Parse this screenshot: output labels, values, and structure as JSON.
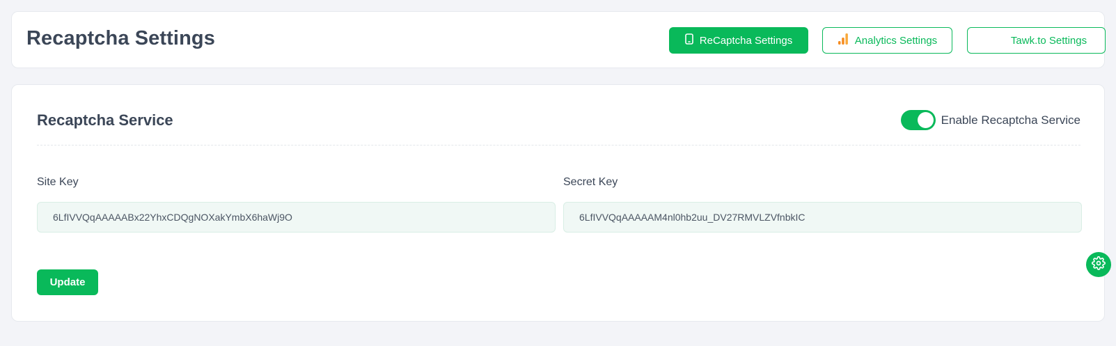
{
  "page": {
    "title": "Recaptcha Settings"
  },
  "header_buttons": {
    "recaptcha": {
      "label": "ReCaptcha Settings",
      "icon": "phone-icon"
    },
    "analytics": {
      "label": "Analytics Settings",
      "icon": "bar-chart-icon"
    },
    "tawk": {
      "label": "Tawk.to Settings"
    }
  },
  "service": {
    "title": "Recaptcha Service",
    "toggle_label": "Enable Recaptcha Service",
    "toggle_on": true
  },
  "fields": {
    "site_key": {
      "label": "Site Key",
      "value": "6LfIVVQqAAAAABx22YhxCDQgNOXakYmbX6haWj9O"
    },
    "secret_key": {
      "label": "Secret Key",
      "value": "6LfIVVQqAAAAAM4nl0hb2uu_DV27RMVLZVfnbkIC"
    }
  },
  "actions": {
    "update_label": "Update"
  },
  "floating": {
    "icon": "gear-icon"
  },
  "colors": {
    "accent": "#09b95a",
    "analytics_icon": "#f68b1f",
    "text": "#3b4657"
  }
}
